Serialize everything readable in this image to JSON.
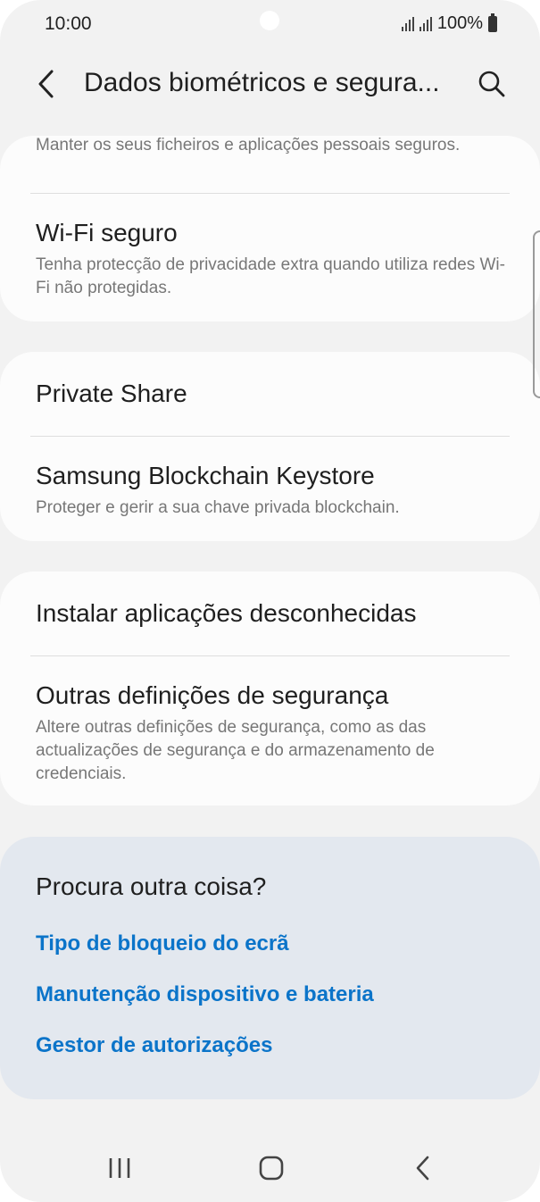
{
  "status_bar": {
    "time": "10:00",
    "battery": "100%"
  },
  "header": {
    "title": "Dados biométricos e segura...",
    "back_icon": "chevron-left-icon",
    "search_icon": "search-icon"
  },
  "cards": [
    {
      "items": [
        {
          "subtitle": "Manter os seus ficheiros e aplicações pessoais seguros."
        },
        {
          "title": "Wi-Fi seguro",
          "subtitle": "Tenha protecção de privacidade extra quando utiliza redes Wi-Fi não protegidas."
        }
      ]
    },
    {
      "items": [
        {
          "title": "Private Share"
        },
        {
          "title": "Samsung Blockchain Keystore",
          "subtitle": "Proteger e gerir a sua chave privada blockchain."
        }
      ]
    },
    {
      "items": [
        {
          "title": "Instalar aplicações desconhecidas"
        },
        {
          "title": "Outras definições de segurança",
          "subtitle": "Altere outras definições de segurança, como as das actualizações de segurança e do armazenamento de credenciais."
        }
      ]
    }
  ],
  "suggestions": {
    "title": "Procura outra coisa?",
    "links": [
      "Tipo de bloqueio do ecrã",
      "Manutenção dispositivo e bateria",
      "Gestor de autorizações"
    ]
  },
  "colors": {
    "background": "#f2f2f2",
    "card": "#fcfcfc",
    "suggestion_card": "#e3e8ef",
    "link": "#0b74c9"
  },
  "nav_bar": {
    "recents_icon": "recents-icon",
    "home_icon": "home-icon",
    "back_icon": "back-icon"
  }
}
